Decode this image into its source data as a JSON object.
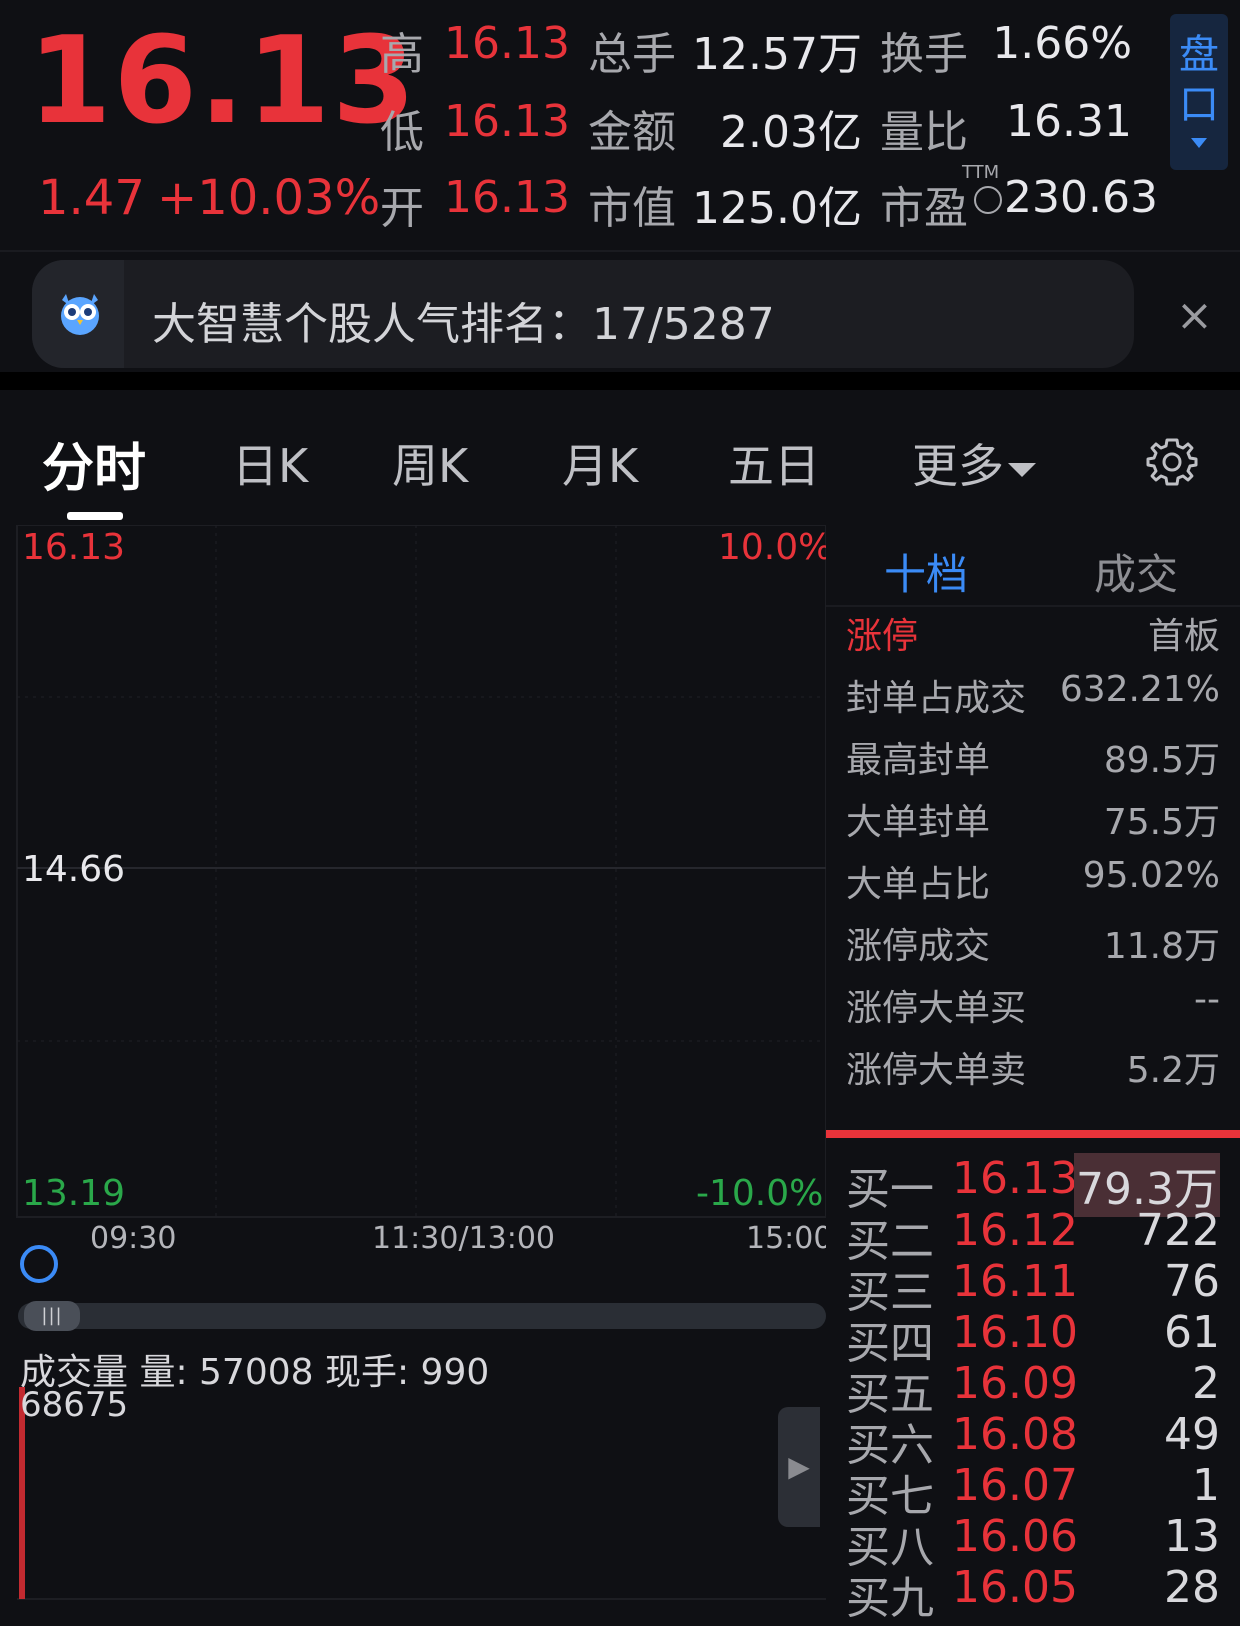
{
  "header": {
    "price": "16.13",
    "change": "1.47",
    "change_pct": "+10.03%",
    "stats": {
      "high_label": "高",
      "high_value": "16.13",
      "low_label": "低",
      "low_value": "16.13",
      "open_label": "开",
      "open_value": "16.13",
      "volume_label": "总手",
      "volume_value": "12.57万",
      "amount_label": "金额",
      "amount_value": "2.03亿",
      "mktcap_label": "市值",
      "mktcap_value": "125.0亿",
      "turnover_label": "换手",
      "turnover_value": "1.66%",
      "volratio_label": "量比",
      "volratio_value": "16.31",
      "pe_label": "市盈",
      "pe_sup": "TTM",
      "pe_value": "230.63"
    },
    "pankou_label": "盘口"
  },
  "banner": {
    "text": "大智慧个股人气排名：17/5287",
    "close": "×"
  },
  "tabs": [
    {
      "label": "分时",
      "active": true
    },
    {
      "label": "日K"
    },
    {
      "label": "周K"
    },
    {
      "label": "月K"
    },
    {
      "label": "五日"
    },
    {
      "label": "更多"
    }
  ],
  "chart": {
    "y_top": "16.13",
    "y_mid": "14.66",
    "y_bottom": "13.19",
    "pct_top": "10.0%",
    "pct_bottom": "-10.0%",
    "time_start": "09:30",
    "time_mid": "11:30/13:00",
    "time_end": "15:00",
    "volume_title": "成交量 量: 57008  现手: 990",
    "volume_max": "68675"
  },
  "panel": {
    "tab_depth": "十档",
    "tab_trades": "成交",
    "limit_header_left": "涨停",
    "limit_header_right": "首板",
    "limit_stats": [
      {
        "label": "封单占成交",
        "value": "632.21%"
      },
      {
        "label": "最高封单",
        "value": "89.5万"
      },
      {
        "label": "大单封单",
        "value": "75.5万"
      },
      {
        "label": "大单占比",
        "value": "95.02%"
      },
      {
        "label": "涨停成交",
        "value": "11.8万"
      },
      {
        "label": "涨停大单买",
        "value": "--"
      },
      {
        "label": "涨停大单卖",
        "value": "5.2万"
      }
    ],
    "bids": [
      {
        "label": "买一",
        "price": "16.13",
        "volume": "79.3万"
      },
      {
        "label": "买二",
        "price": "16.12",
        "volume": "722"
      },
      {
        "label": "买三",
        "price": "16.11",
        "volume": "76"
      },
      {
        "label": "买四",
        "price": "16.10",
        "volume": "61"
      },
      {
        "label": "买五",
        "price": "16.09",
        "volume": "2"
      },
      {
        "label": "买六",
        "price": "16.08",
        "volume": "49"
      },
      {
        "label": "买七",
        "price": "16.07",
        "volume": "1"
      },
      {
        "label": "买八",
        "price": "16.06",
        "volume": "13"
      },
      {
        "label": "买九",
        "price": "16.05",
        "volume": "28"
      }
    ]
  },
  "colors": {
    "up": "#e8333a",
    "down": "#2aa84a",
    "accent": "#3b8bf6"
  }
}
